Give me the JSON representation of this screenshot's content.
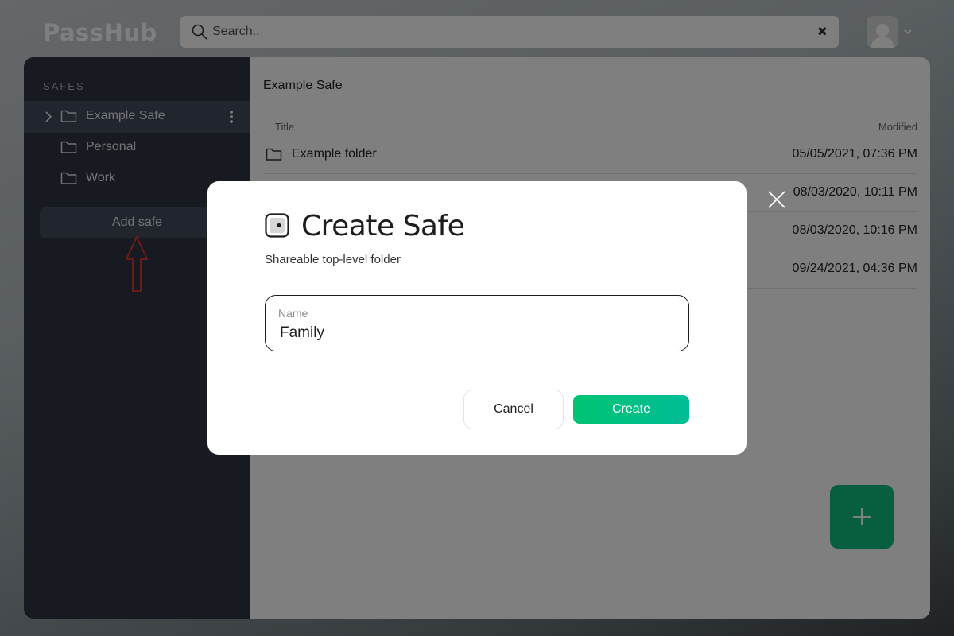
{
  "app": {
    "logo": "PassHub"
  },
  "search": {
    "placeholder": "Search..",
    "value": ""
  },
  "sidebar": {
    "heading": "SAFES",
    "safes": [
      {
        "label": "Example Safe",
        "active": true
      },
      {
        "label": "Personal"
      },
      {
        "label": "Work"
      }
    ],
    "add_safe_label": "Add safe"
  },
  "content": {
    "breadcrumb": "Example Safe",
    "columns": {
      "title": "Title",
      "modified": "Modified"
    },
    "rows": [
      {
        "title": "Example folder",
        "modified": "05/05/2021, 07:36 PM"
      },
      {
        "title": "",
        "modified": "08/03/2020, 10:11 PM"
      },
      {
        "title": "",
        "modified": "08/03/2020, 10:16 PM"
      },
      {
        "title": "",
        "modified": "09/24/2021, 04:36 PM"
      }
    ]
  },
  "modal": {
    "title": "Create Safe",
    "subtitle": "Shareable top-level folder",
    "name_label": "Name",
    "name_value": "Family",
    "cancel_label": "Cancel",
    "create_label": "Create"
  },
  "colors": {
    "accent": "#0fbf7e",
    "sidebar_bg": "#2f3442",
    "annotation_arrow": "#e53935"
  }
}
